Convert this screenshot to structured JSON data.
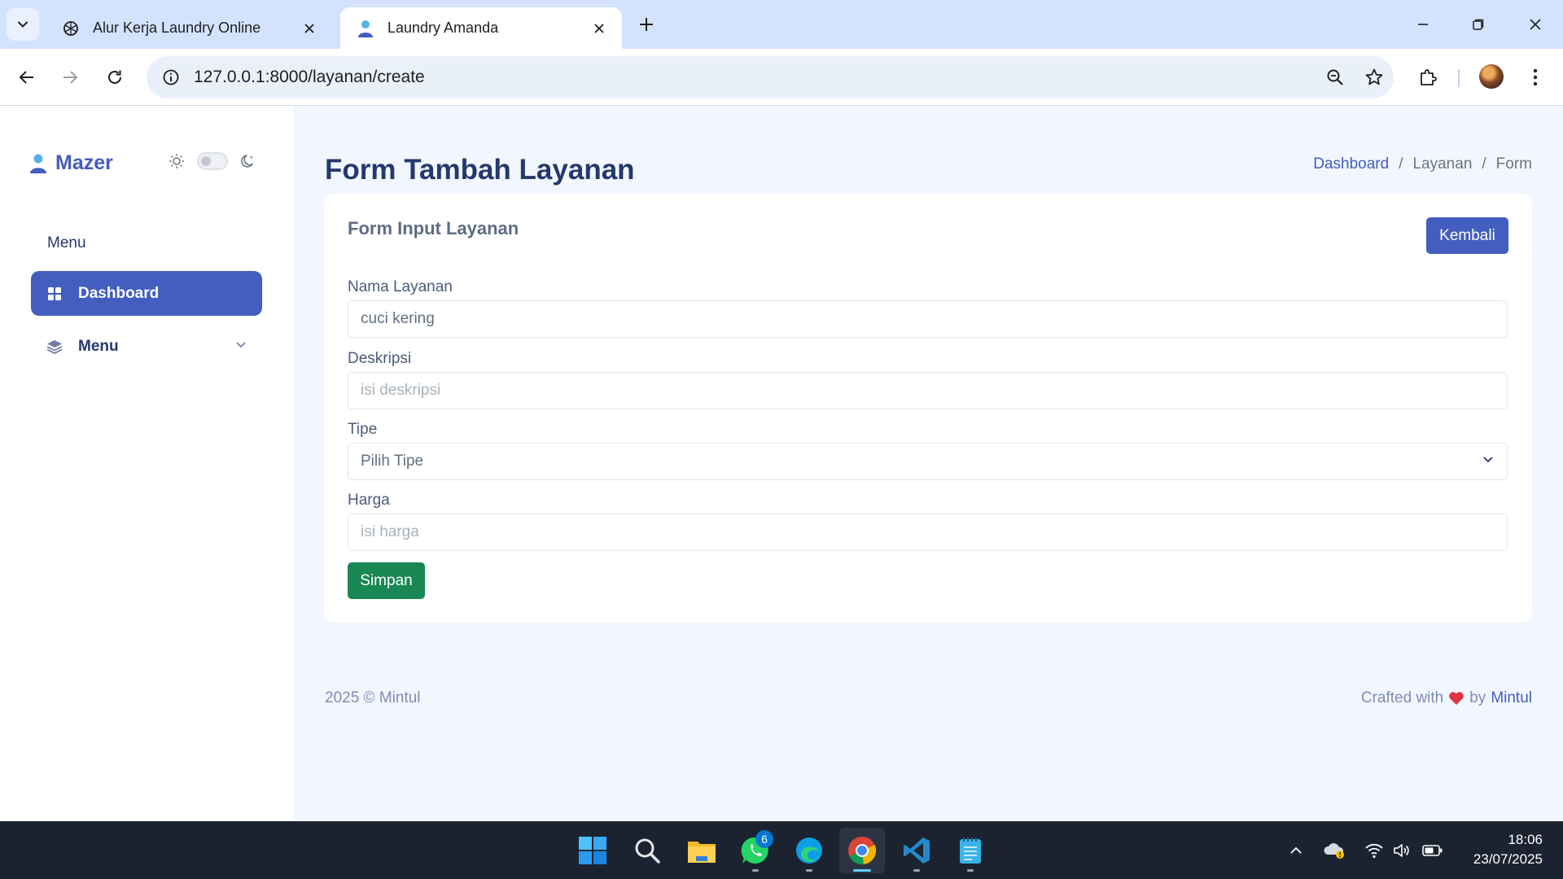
{
  "browser": {
    "tabs": [
      {
        "title": "Alur Kerja Laundry Online",
        "active": false
      },
      {
        "title": "Laundry Amanda",
        "active": true
      }
    ],
    "url": "127.0.0.1:8000/layanan/create"
  },
  "sidebar": {
    "brand": "Mazer",
    "menu_title": "Menu",
    "items": [
      {
        "label": "Dashboard",
        "active": true,
        "icon": "grid-icon"
      },
      {
        "label": "Menu",
        "active": false,
        "icon": "layers-icon"
      }
    ]
  },
  "page": {
    "title": "Form Tambah Layanan",
    "breadcrumb": [
      "Dashboard",
      "Layanan",
      "Form"
    ]
  },
  "form": {
    "card_title": "Form Input Layanan",
    "back_button": "Kembali",
    "fields": {
      "nama": {
        "label": "Nama Layanan",
        "value": "cuci kering",
        "placeholder": ""
      },
      "deskripsi": {
        "label": "Deskripsi",
        "value": "",
        "placeholder": "isi deskripsi"
      },
      "tipe": {
        "label": "Tipe",
        "selected": "Pilih Tipe"
      },
      "harga": {
        "label": "Harga",
        "value": "",
        "placeholder": "isi harga"
      }
    },
    "submit_button": "Simpan"
  },
  "footer": {
    "copyright": "2025 © Mintul",
    "crafted_prefix": "Crafted with",
    "crafted_by": "by",
    "author": "Mintul"
  },
  "taskbar": {
    "whatsapp_badge": "6",
    "time": "18:06",
    "date": "23/07/2025"
  },
  "colors": {
    "primary": "#435ebe",
    "success": "#198754",
    "page_bg": "#f2f7ff",
    "heart": "#dc3545"
  }
}
